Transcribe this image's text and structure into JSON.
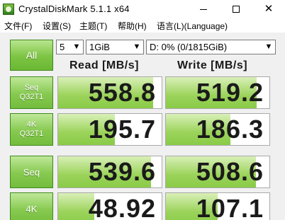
{
  "window": {
    "title": "CrystalDiskMark 5.1.1 x64",
    "controls": {
      "minimize": "min",
      "maximize": "max",
      "close": "✕"
    }
  },
  "menu": [
    {
      "label": "文件(F)"
    },
    {
      "label": "设置(S)"
    },
    {
      "label": "主题(T)"
    },
    {
      "label": "帮助(H)"
    },
    {
      "label": "语言(L)(Language)"
    }
  ],
  "toolbar": {
    "all_label": "All",
    "test_count": "5",
    "test_size": "1GiB",
    "drive": "D: 0% (0/1815GiB)"
  },
  "headers": {
    "read": "Read [MB/s]",
    "write": "Write [MB/s]"
  },
  "rows": [
    {
      "label_line1": "Seq",
      "label_line2": "Q32T1",
      "read": "558.8",
      "write": "519.2",
      "read_fill": 0.92,
      "write_fill": 0.88
    },
    {
      "label_line1": "4K",
      "label_line2": "Q32T1",
      "read": "195.7",
      "write": "186.3",
      "read_fill": 0.55,
      "write_fill": 0.62
    },
    {
      "label_line1": "Seq",
      "label_line2": "",
      "read": "539.6",
      "write": "508.6",
      "read_fill": 0.9,
      "write_fill": 0.87
    },
    {
      "label_line1": "4K",
      "label_line2": "",
      "read": "48.92",
      "write": "107.1",
      "read_fill": 0.35,
      "write_fill": 0.5
    }
  ],
  "colors": {
    "accent": "#7dc443",
    "bar": "#9bd35a"
  }
}
